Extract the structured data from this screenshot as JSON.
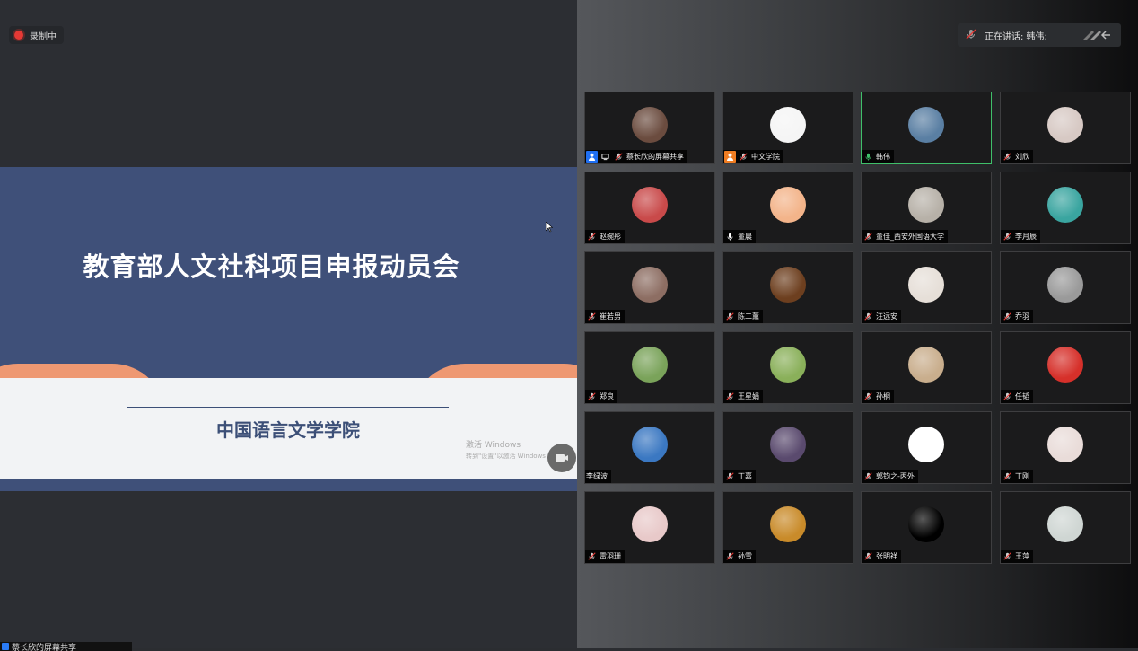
{
  "recording": {
    "label": "录制中"
  },
  "speaking": {
    "label": "正在讲话: 韩伟;"
  },
  "slide": {
    "title": "教育部人文社科项目申报动员会",
    "subtitle": "中国语言文学学院",
    "watermark_line1": "激活 Windows",
    "watermark_line2": "转到\"设置\"以激活 Windows"
  },
  "bottom_tab": {
    "label": "蔡长欣的屏幕共享"
  },
  "participants": [
    {
      "name": "蔡长欣的屏幕共享",
      "avatar": "#6b4c3f",
      "icon": "share"
    },
    {
      "name": "中文学院",
      "avatar": "#f5f5f5",
      "icon": "host"
    },
    {
      "name": "韩伟",
      "avatar": "#5a7fa3",
      "icon": "mic-on",
      "active": true
    },
    {
      "name": "刘欣",
      "avatar": "#d7c9c4",
      "icon": "muted"
    },
    {
      "name": "赵婉彤",
      "avatar": "#c94a4a",
      "icon": "muted"
    },
    {
      "name": "董晨",
      "avatar": "#f3b48a",
      "icon": "mic-on"
    },
    {
      "name": "董佳_西安外国语大学",
      "avatar": "#b7b1a8",
      "icon": "muted"
    },
    {
      "name": "李月辰",
      "avatar": "#3aa5a0",
      "icon": "muted"
    },
    {
      "name": "崔若男",
      "avatar": "#8d6e63",
      "icon": "muted"
    },
    {
      "name": "陈二薰",
      "avatar": "#6d3f1f",
      "icon": "muted"
    },
    {
      "name": "汪远安",
      "avatar": "#e6dfd8",
      "icon": "muted"
    },
    {
      "name": "乔羽",
      "avatar": "#9a9a9a",
      "icon": "muted"
    },
    {
      "name": "郑良",
      "avatar": "#7aa35a",
      "icon": "muted"
    },
    {
      "name": "王星娟",
      "avatar": "#8ab05a",
      "icon": "muted"
    },
    {
      "name": "孙桐",
      "avatar": "#c9ae8d",
      "icon": "muted"
    },
    {
      "name": "任韬",
      "avatar": "#d6302a",
      "icon": "muted"
    },
    {
      "name": "李绿波",
      "avatar": "#3b78c2",
      "icon": "none"
    },
    {
      "name": "丁嘉",
      "avatar": "#5a4a6e",
      "icon": "muted"
    },
    {
      "name": "郭钧之-丙外",
      "avatar": "#ffffff",
      "icon": "muted"
    },
    {
      "name": "丁刚",
      "avatar": "#e9dcd9",
      "icon": "muted"
    },
    {
      "name": "雷羽珊",
      "avatar": "#e8c9c9",
      "icon": "muted"
    },
    {
      "name": "孙雪",
      "avatar": "#c98b2a",
      "icon": "muted"
    },
    {
      "name": "张明祥",
      "avatar": "#000000",
      "icon": "muted"
    },
    {
      "name": "王萍",
      "avatar": "#cfd6d3",
      "icon": "muted"
    }
  ]
}
